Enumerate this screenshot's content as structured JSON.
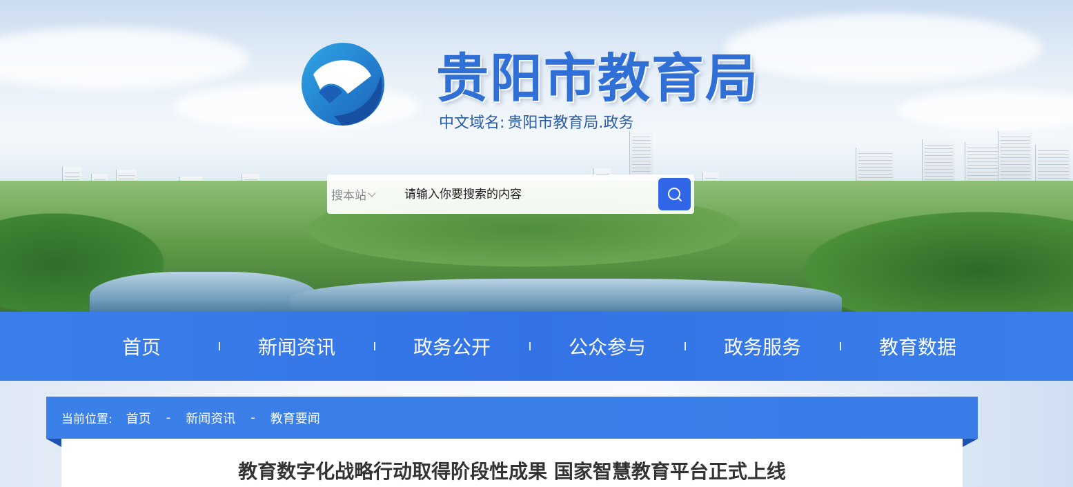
{
  "header": {
    "site_title": "贵阳市教育局",
    "domain_label": "中文域名:",
    "domain_value": "贵阳市教育局.政务"
  },
  "search": {
    "scope_label": "搜本站",
    "placeholder": "请输入你要搜索的内容",
    "button_icon": "search-icon"
  },
  "nav": {
    "items": [
      {
        "label": "首页"
      },
      {
        "label": "新闻资讯"
      },
      {
        "label": "政务公开"
      },
      {
        "label": "公众参与"
      },
      {
        "label": "政务服务"
      },
      {
        "label": "教育数据"
      }
    ]
  },
  "breadcrumb": {
    "prefix": "当前位置:",
    "items": [
      "首页",
      "新闻资讯",
      "教育要闻"
    ],
    "separator": "-"
  },
  "article": {
    "title": "教育数字化战略行动取得阶段性成果  国家智慧教育平台正式上线"
  },
  "colors": {
    "brand_blue": "#3373e6",
    "title_blue": "#2f6fd6",
    "search_button": "#3166e8",
    "article_title": "#333333"
  }
}
